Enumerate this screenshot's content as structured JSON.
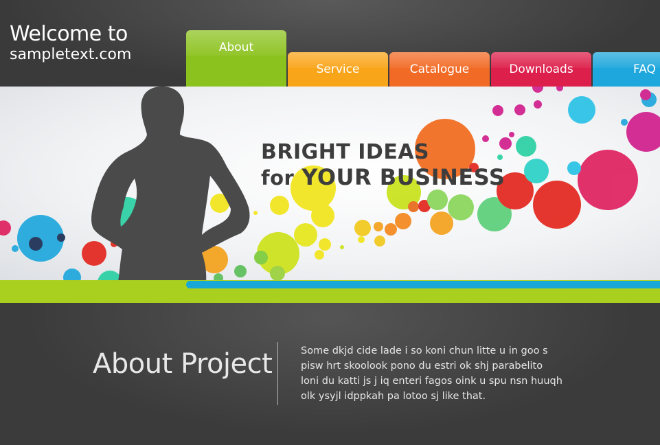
{
  "header": {
    "logo_line1": "Welcome to",
    "logo_line2": "sampletext.com"
  },
  "nav": {
    "tabs": [
      {
        "label": "About",
        "color": "#8cc21e"
      },
      {
        "label": "Service",
        "color": "#f9a51a"
      },
      {
        "label": "Catalogue",
        "color": "#f26b26"
      },
      {
        "label": "Downloads",
        "color": "#dd1f4b"
      },
      {
        "label": "FAQ",
        "color": "#1ea7dc"
      }
    ]
  },
  "banner": {
    "headline_line1": "BRIGHT IDEAS",
    "headline_for": "for",
    "headline_rest": "YOUR BUSINESS"
  },
  "about": {
    "title": "About Project",
    "lines": [
      "Some dkjd  cide lade i so koni chun litte u in goo s",
      "pisw hrt skoolook pono du estri ok shj parabelito",
      "loni du katti js j iq enteri fagos oink u spu nsn huuqh",
      "olk ysyjl idppkah pa lotoo sj like that."
    ]
  },
  "colors": {
    "green": "#a9d01f",
    "blue": "#18a8d8",
    "dark": "#3a3a3a",
    "silhouette": "#4a4a4a"
  }
}
